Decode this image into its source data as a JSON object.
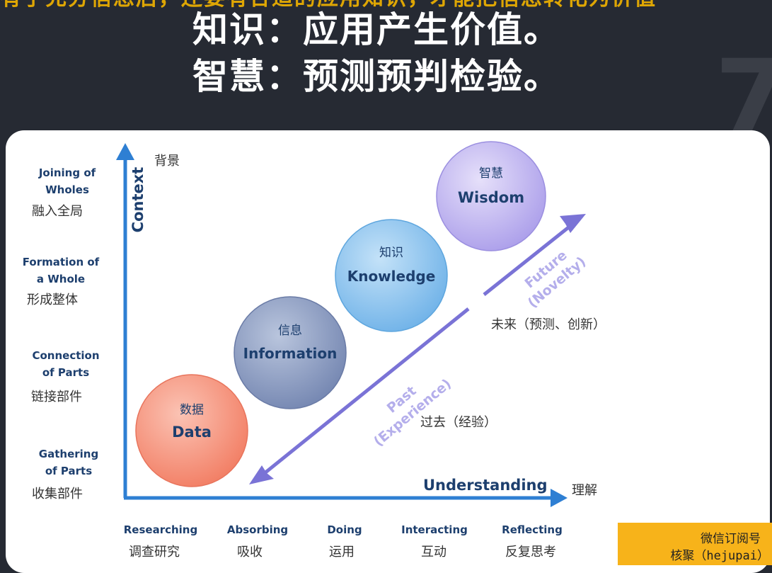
{
  "header": {
    "top_strip": "有了充分信息后，还要有合适的应用知识，才能把信息转化为价值",
    "line1": "知识：应用产生价值。",
    "line2": "智慧：预测预判检验。"
  },
  "diagram": {
    "y_axis": {
      "label": "Context",
      "label_cn": "背景"
    },
    "x_axis": {
      "label": "Understanding",
      "label_cn": "理解"
    },
    "y_levels": [
      {
        "en1": "Joining of",
        "en2": "Wholes",
        "cn": "融入全局"
      },
      {
        "en1": "Formation of",
        "en2": "a Whole",
        "cn": "形成整体"
      },
      {
        "en1": "Connection",
        "en2": "of Parts",
        "cn": "链接部件"
      },
      {
        "en1": "Gathering",
        "en2": "of Parts",
        "cn": "收集部件"
      }
    ],
    "x_levels": [
      {
        "en": "Researching",
        "cn": "调查研究"
      },
      {
        "en": "Absorbing",
        "cn": "吸收"
      },
      {
        "en": "Doing",
        "cn": "运用"
      },
      {
        "en": "Interacting",
        "cn": "互动"
      },
      {
        "en": "Reflecting",
        "cn": "反复思考"
      }
    ],
    "circles": [
      {
        "cn": "数据",
        "en": "Data",
        "color": "#f4937e"
      },
      {
        "cn": "信息",
        "en": "Information",
        "color": "#8b9cc2"
      },
      {
        "cn": "知识",
        "en": "Knowledge",
        "color": "#88c3ee"
      },
      {
        "cn": "智慧",
        "en": "Wisdom",
        "color": "#c2b8ef"
      }
    ],
    "arrow": {
      "future_en1": "Future",
      "future_en2": "(Novelty)",
      "future_cn": "未来（预测、创新）",
      "past_en1": "Past",
      "past_en2": "(Experience)",
      "past_cn": "过去（经验）"
    }
  },
  "watermark": {
    "line1": "微信订阅号",
    "line2": "核聚（hejupai）"
  },
  "colors": {
    "axis_blue": "#2e7fd3",
    "label_navy": "#1d3f6e",
    "arrow_purple": "#7a73d6"
  }
}
